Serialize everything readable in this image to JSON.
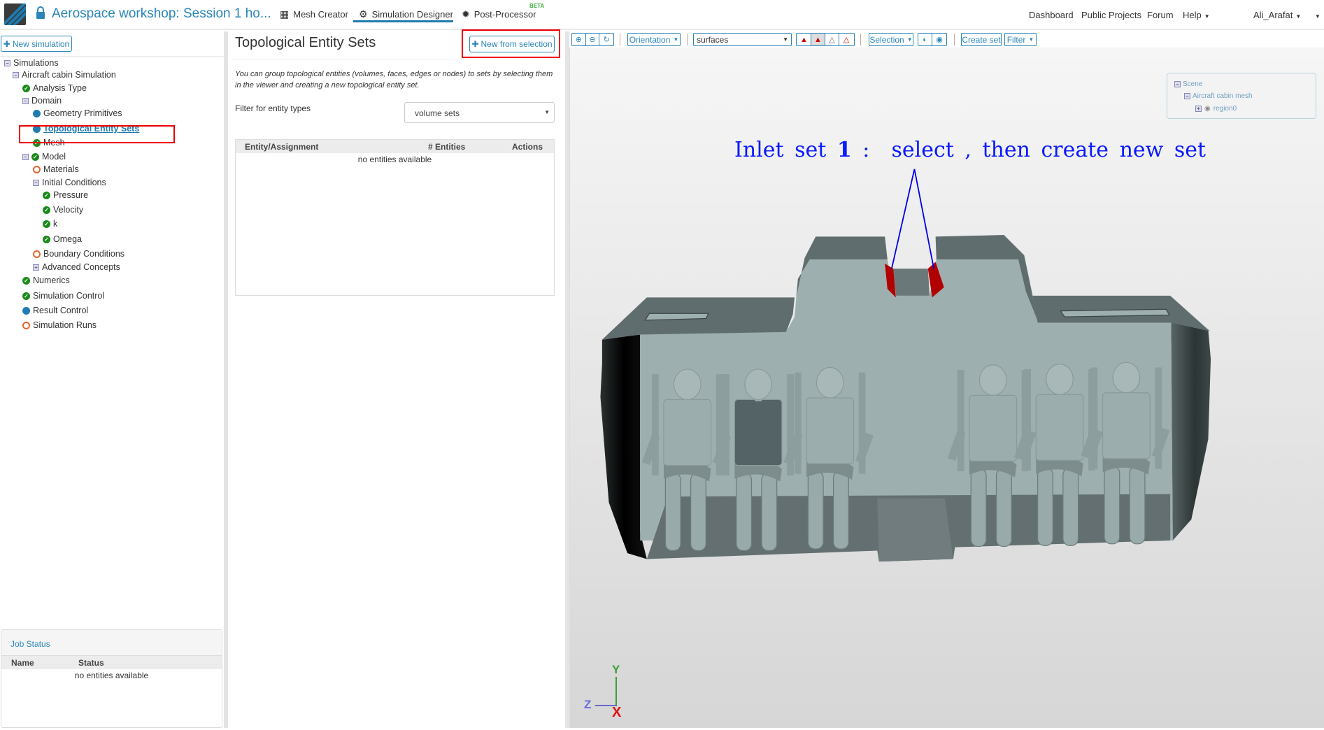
{
  "header": {
    "project_title": "Aerospace workshop: Session 1 ho...",
    "nav": [
      {
        "label": "Mesh Creator",
        "icon": "grid-icon"
      },
      {
        "label": "Simulation Designer",
        "icon": "gears-icon"
      },
      {
        "label": "Post-Processor",
        "icon": "gear-icon",
        "badge": "BETA"
      }
    ],
    "right": {
      "dashboard": "Dashboard",
      "public_projects": "Public Projects",
      "forum": "Forum",
      "help": "Help",
      "user": "Ali_Arafat"
    }
  },
  "sidebar": {
    "new_simulation": "New simulation",
    "tree": [
      {
        "label": "Simulations",
        "status": "toggle-minus"
      },
      {
        "label": "Aircraft cabin Simulation",
        "status": "toggle-minus"
      },
      {
        "label": "Analysis Type",
        "status": "ok"
      },
      {
        "label": "Domain",
        "status": "toggle-minus"
      },
      {
        "label": "Geometry Primitives",
        "status": "info"
      },
      {
        "label": "Topological Entity Sets",
        "status": "info",
        "selected": true
      },
      {
        "label": "Mesh",
        "status": "ok"
      },
      {
        "label": "Model",
        "status": "ok"
      },
      {
        "label": "Materials",
        "status": "incomplete"
      },
      {
        "label": "Initial Conditions",
        "status": "toggle-minus"
      },
      {
        "label": "Pressure",
        "status": "ok"
      },
      {
        "label": "Velocity",
        "status": "ok"
      },
      {
        "label": "k",
        "status": "ok"
      },
      {
        "label": "Omega",
        "status": "ok"
      },
      {
        "label": "Boundary Conditions",
        "status": "incomplete"
      },
      {
        "label": "Advanced Concepts",
        "status": "toggle-plus"
      },
      {
        "label": "Numerics",
        "status": "ok"
      },
      {
        "label": "Simulation Control",
        "status": "ok"
      },
      {
        "label": "Result Control",
        "status": "info"
      },
      {
        "label": "Simulation Runs",
        "status": "incomplete"
      }
    ],
    "job_status": {
      "title": "Job Status",
      "columns": [
        "Name",
        "Status"
      ],
      "empty": "no entities available"
    }
  },
  "panel": {
    "title": "Topological Entity Sets",
    "new_from_selection": "New from selection",
    "description": "You can group topological entities (volumes, faces, edges or nodes) to sets by selecting them in the viewer and creating a new topological entity set.",
    "filter_label": "Filter for entity types",
    "filter_value": "volume sets",
    "table": {
      "columns": [
        "Entity/Assignment",
        "# Entities",
        "Actions"
      ],
      "empty": "no entities available"
    }
  },
  "viewer": {
    "toolbar": {
      "orientation": "Orientation",
      "render_mode": "surfaces",
      "selection": "Selection",
      "create_set": "Create set",
      "filter": "Filter"
    },
    "scene_tree": {
      "root": "Scene",
      "mesh": "Aircraft cabin mesh",
      "region": "region0"
    },
    "annotation": {
      "part1": "Inlet set",
      "number": "1",
      "colon": ":",
      "part2": "select",
      ",": ",",
      "part3": "then create new set"
    },
    "axes": {
      "x": "X",
      "y": "Y",
      "z": "Z"
    }
  }
}
